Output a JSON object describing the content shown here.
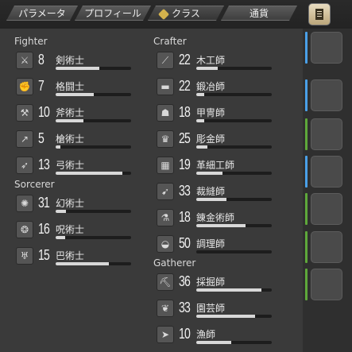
{
  "tabs": [
    {
      "label": "パラメータ"
    },
    {
      "label": "プロフィール"
    },
    {
      "label": "クラス"
    },
    {
      "label": "通貨"
    }
  ],
  "sections": {
    "fighter": "Fighter",
    "sorcerer": "Sorcerer",
    "crafter": "Crafter",
    "gatherer": "Gatherer"
  },
  "fighter_jobs": [
    {
      "level": "8",
      "name": "剣術士",
      "progress": 0.58,
      "icon": "sword-icon"
    },
    {
      "level": "7",
      "name": "格闘士",
      "progress": 0.5,
      "icon": "fist-icon"
    },
    {
      "level": "10",
      "name": "斧術士",
      "progress": 0.37,
      "icon": "axe-icon"
    },
    {
      "level": "5",
      "name": "槍術士",
      "progress": 0.06,
      "icon": "spear-icon"
    },
    {
      "level": "13",
      "name": "弓術士",
      "progress": 0.88,
      "icon": "bow-icon"
    }
  ],
  "sorcerer_jobs": [
    {
      "level": "31",
      "name": "幻術士",
      "progress": 0.14,
      "icon": "conjurer-icon"
    },
    {
      "level": "16",
      "name": "呪術士",
      "progress": 0.13,
      "icon": "thaumaturge-icon"
    },
    {
      "level": "15",
      "name": "巴術士",
      "progress": 0.7,
      "icon": "arcanist-icon"
    }
  ],
  "crafter_jobs": [
    {
      "level": "22",
      "name": "木工師",
      "progress": 0.28,
      "icon": "saw-icon"
    },
    {
      "level": "22",
      "name": "鍛冶師",
      "progress": 0.11,
      "icon": "anvil-icon"
    },
    {
      "level": "18",
      "name": "甲冑師",
      "progress": 0.1,
      "icon": "helmet-icon"
    },
    {
      "level": "25",
      "name": "彫金師",
      "progress": 0.15,
      "icon": "tiara-icon"
    },
    {
      "level": "19",
      "name": "革細工師",
      "progress": 0.35,
      "icon": "leather-icon"
    },
    {
      "level": "33",
      "name": "裁縫師",
      "progress": 0.4,
      "icon": "needle-icon"
    },
    {
      "level": "18",
      "name": "錬金術師",
      "progress": 0.65,
      "icon": "flask-icon"
    },
    {
      "level": "50",
      "name": "調理師",
      "progress": 0.0,
      "icon": "dish-icon"
    }
  ],
  "gatherer_jobs": [
    {
      "level": "36",
      "name": "採掘師",
      "progress": 0.86,
      "icon": "pickaxe-icon"
    },
    {
      "level": "33",
      "name": "園芸師",
      "progress": 0.78,
      "icon": "leaf-icon"
    },
    {
      "level": "10",
      "name": "漁師",
      "progress": 0.46,
      "icon": "fish-icon"
    }
  ],
  "gear_slots": [
    {
      "icon": "frying-pan-icon",
      "accent": "#4aa0e8"
    },
    {
      "icon": "chef-hat-icon",
      "accent": "#4aa0e8"
    },
    {
      "icon": "shirt-icon",
      "accent": "#5ea83a"
    },
    {
      "icon": "gloves-icon",
      "accent": "#4aa0e8"
    },
    {
      "icon": "belt-icon",
      "accent": "#5ea83a"
    },
    {
      "icon": "trousers-icon",
      "accent": "#5ea83a"
    },
    {
      "icon": "boots-icon",
      "accent": "#5ea83a"
    }
  ]
}
